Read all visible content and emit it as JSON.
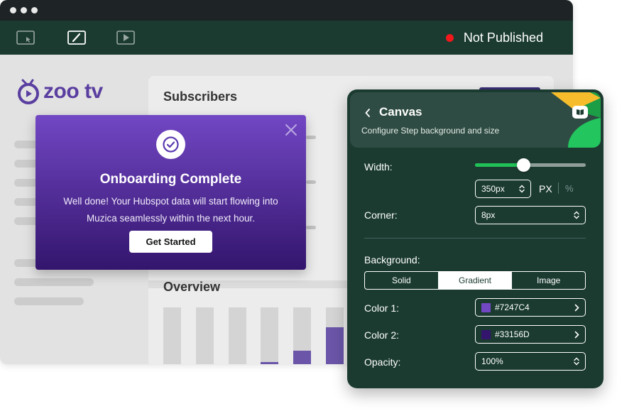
{
  "toolbar": {
    "status_text": "Not Published",
    "status_color": "#F2181B",
    "icons": [
      "cursor-select-icon",
      "edit-icon",
      "play-icon"
    ]
  },
  "app": {
    "logo_text": "zoo tv",
    "subscribers_title": "Subscribers",
    "overview_title": "Overview",
    "overview_bars": [
      0,
      0.03,
      0,
      0.08,
      0.27,
      0.67
    ]
  },
  "modal": {
    "title": "Onboarding Complete",
    "body": "Well done! Your Hubspot data will start flowing into Muzica seamlessly within the next hour.",
    "button_label": "Get Started",
    "close_icon": "close-icon",
    "check_icon": "check-circle-icon"
  },
  "panel": {
    "title": "Canvas",
    "subtitle": "Configure Step background and size",
    "width_label": "Width:",
    "width_slider": 0.44,
    "width_value": "350px",
    "unit_px": "PX",
    "unit_percent": "%",
    "corner_label": "Corner:",
    "corner_value": "8px",
    "background_label": "Background:",
    "background_options": [
      "Solid",
      "Gradient",
      "Image"
    ],
    "background_selected": "Gradient",
    "color1_label": "Color 1:",
    "color1_value": "#7247C4",
    "color2_label": "Color 2:",
    "color2_value": "#33156D",
    "opacity_label": "Opacity:",
    "opacity_value": "100%",
    "accent": "#20C157"
  }
}
